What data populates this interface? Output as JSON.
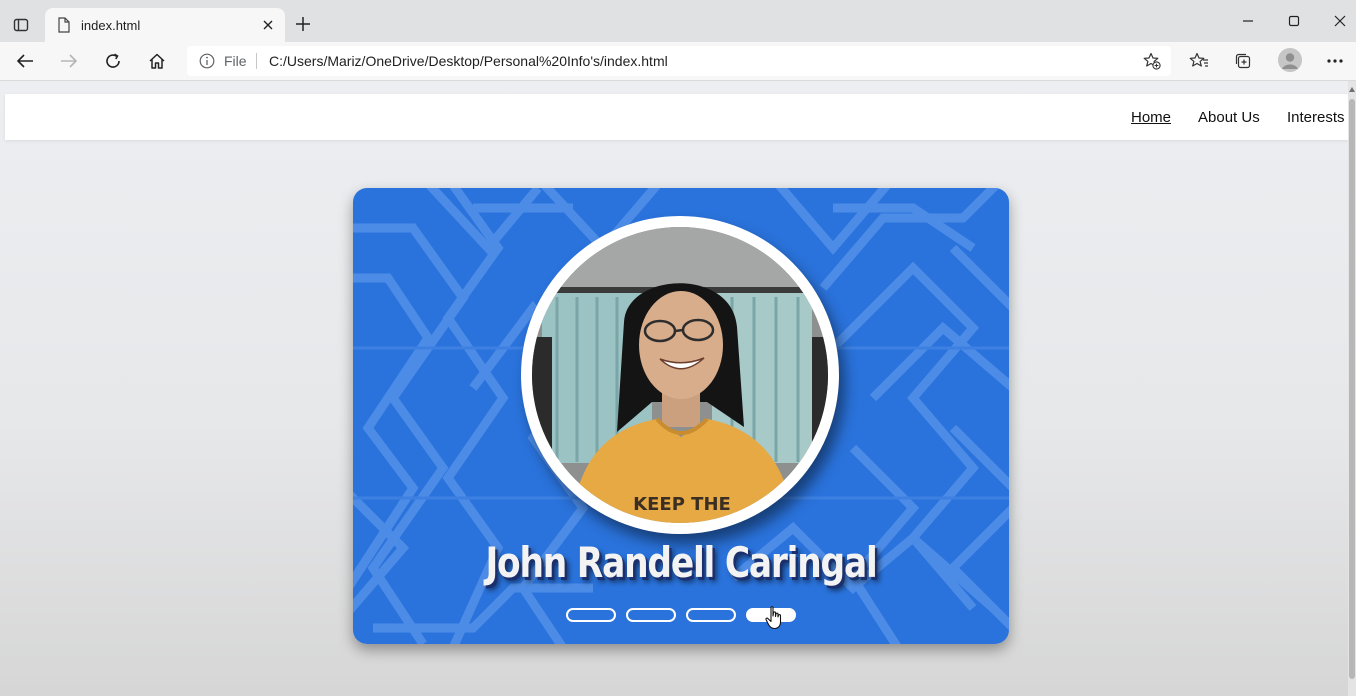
{
  "browser": {
    "tab_title": "index.html",
    "address": {
      "file_label": "File",
      "url": "C:/Users/Mariz/OneDrive/Desktop/Personal%20Info's/index.html"
    },
    "icons": {
      "tab_actions": "tab-actions-icon",
      "page": "document-icon",
      "close": "close-icon",
      "new_tab": "plus-icon",
      "back": "back-arrow-icon",
      "forward": "forward-arrow-icon",
      "refresh": "refresh-icon",
      "home": "home-icon",
      "info": "info-icon",
      "add_favorite": "star-plus-icon",
      "favorites": "favorites-icon",
      "collections": "collections-icon",
      "profile": "profile-icon",
      "more": "more-icon"
    }
  },
  "site": {
    "nav": {
      "home": "Home",
      "about": "About Us",
      "interests": "Interests"
    },
    "hero": {
      "name": "John Randell Caringal",
      "photo_text": "KEEP THE",
      "slides_count": 4,
      "active_slide": 4
    }
  },
  "colors": {
    "hero_blue": "#2a73dc",
    "hero_pattern": "#4d8ce6",
    "nav_bg": "#ffffff",
    "page_bg": "#e9ecef"
  }
}
